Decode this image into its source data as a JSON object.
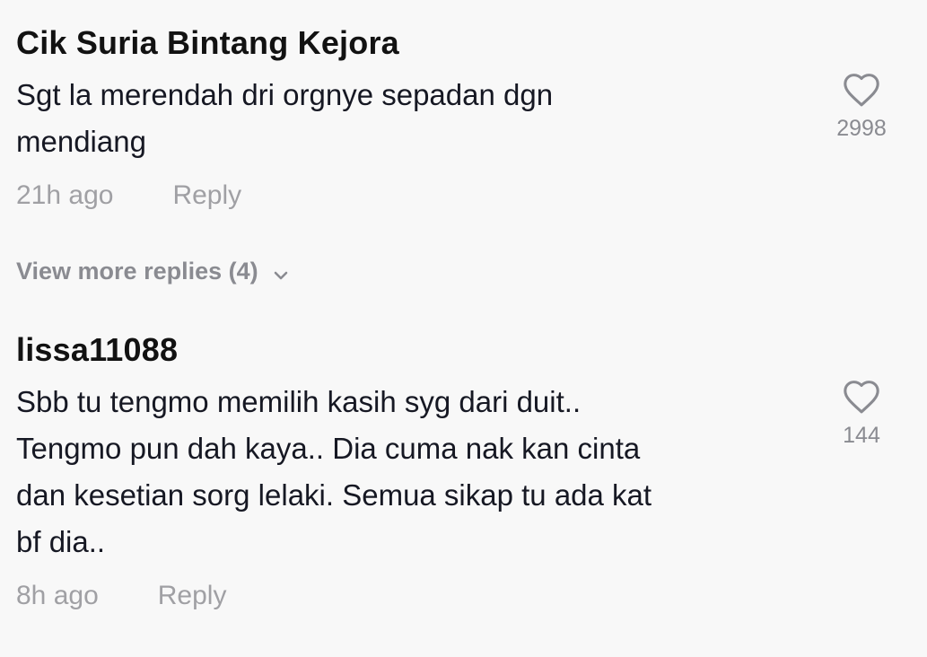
{
  "comments": [
    {
      "username": "Cik Suria Bintang Kejora",
      "text": "Sgt la merendah dri orgnye sepadan dgn\nmendiang",
      "time": "21h ago",
      "reply_label": "Reply",
      "like_count": "2998",
      "like_icon": "heart-outline-icon"
    },
    {
      "username": "lissa11088",
      "text": "Sbb tu tengmo memilih kasih syg dari duit..\nTengmo pun dah kaya.. Dia cuma nak kan cinta\ndan kesetian sorg lelaki. Semua sikap tu ada kat\nbf dia..",
      "time": "8h ago",
      "reply_label": "Reply",
      "like_count": "144",
      "like_icon": "heart-outline-icon"
    }
  ],
  "view_more_replies": {
    "label": "View more replies (4)",
    "icon": "chevron-down-icon"
  },
  "colors": {
    "background": "#f8f8f8",
    "text_primary": "#161823",
    "text_secondary": "#a0a0a4",
    "icon_gray": "#8a8b91"
  }
}
